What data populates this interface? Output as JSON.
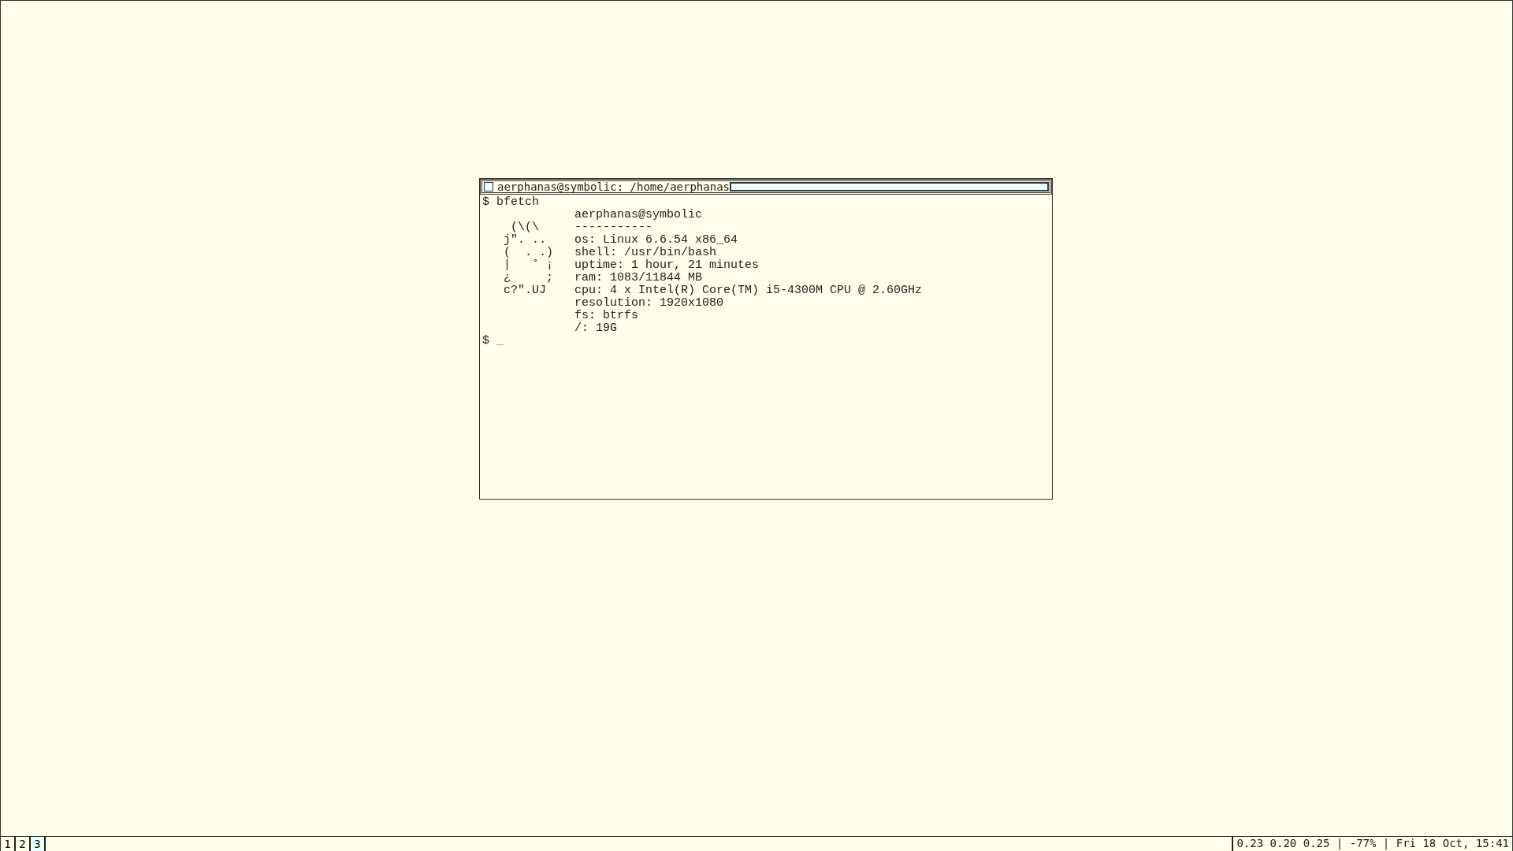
{
  "window": {
    "title": "aerphanas@symbolic: /home/aerphanas"
  },
  "terminal": {
    "command": "$ bfetch",
    "lines": [
      {
        "info": "aerphanas@symbolic"
      },
      {
        "art": "    (\\(\\",
        "info": "-----------"
      },
      {
        "art": "   j\". ..",
        "info": "os: Linux 6.6.54 x86_64"
      },
      {
        "art": "   (  . .)",
        "info": "shell: /usr/bin/bash"
      },
      {
        "art": "   |   ˚ ¡",
        "info": "uptime: 1 hour, 21 minutes"
      },
      {
        "art": "   ¿     ;",
        "info": "ram: 1083/11844 MB"
      },
      {
        "art": "   c?\".UJ",
        "info": "cpu: 4 x Intel(R) Core(TM) i5-4300M CPU @ 2.60GHz"
      },
      {
        "info": "resolution: 1920x1080"
      },
      {
        "info": "fs: btrfs"
      },
      {
        "info": "/: 19G"
      }
    ],
    "prompt": "$",
    "cursor": "_"
  },
  "taskbar": {
    "workspaces": [
      {
        "label": "1",
        "selected": false
      },
      {
        "label": "2",
        "selected": false
      },
      {
        "label": "3",
        "selected": true
      }
    ],
    "status": "0.23 0.20 0.25 | -77% | Fri 18 Oct, 15:41"
  }
}
